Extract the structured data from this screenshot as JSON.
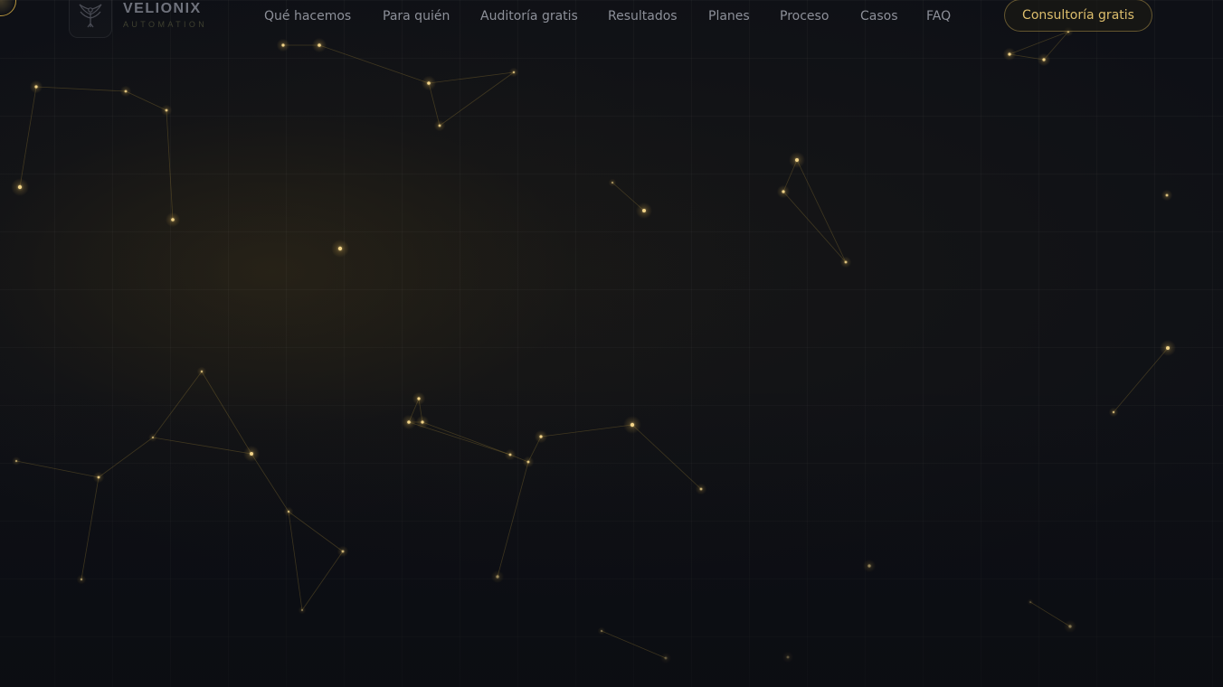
{
  "brand": {
    "name": "VELIONIX",
    "tagline": "AUTOMATION",
    "logo_icon": "phoenix-icon"
  },
  "nav": {
    "items": [
      {
        "label": "Qué hacemos"
      },
      {
        "label": "Para quién"
      },
      {
        "label": "Auditoría gratis"
      },
      {
        "label": "Resultados"
      },
      {
        "label": "Planes"
      },
      {
        "label": "Proceso"
      },
      {
        "label": "Casos"
      },
      {
        "label": "FAQ"
      }
    ],
    "cta_label": "Consultoría gratis"
  },
  "colors": {
    "background": "#0e1016",
    "accent_gold": "#dcbd6c",
    "nav_text": "#8d9099",
    "star": "#f2d489"
  }
}
